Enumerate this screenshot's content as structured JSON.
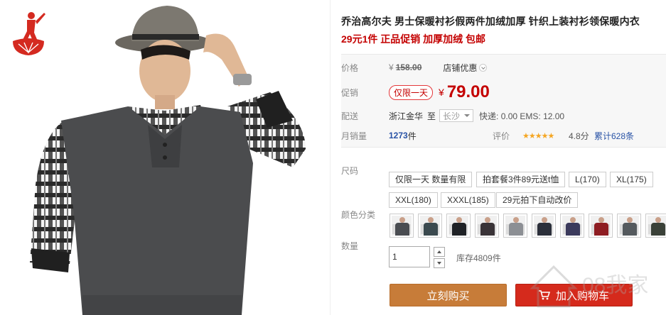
{
  "product": {
    "title": "乔治高尔夫 男士保暖衬衫假两件加绒加厚 针织上装衬衫领保暖内衣",
    "subtitle": "29元1件 正品促销 加厚加绒 包邮"
  },
  "price": {
    "label": "价格",
    "currency": "¥",
    "original": "158.00",
    "shop_discount": "店铺优惠"
  },
  "promo": {
    "label": "促销",
    "badge": "仅限一天",
    "currency": "¥",
    "price": "79.00"
  },
  "delivery": {
    "label": "配送",
    "from": "浙江金华",
    "to": "至",
    "city": "长沙",
    "shipping": "快递: 0.00 EMS: 12.00"
  },
  "sales": {
    "label": "月销量",
    "count": "1273",
    "unit": "件",
    "rating_label": "评价",
    "stars": "★★★★★",
    "score": "4.8分",
    "reviews": "累计628条",
    "rating_value": 4.8
  },
  "sizes": {
    "label": "尺码",
    "options": [
      "仅限一天 数量有限",
      "拍套餐3件89元送t恤",
      "L(170)",
      "XL(175)",
      "XXL(180)",
      "XXXL(185)",
      "29元拍下自动改价"
    ]
  },
  "colors": {
    "label": "颜色分类",
    "swatches": [
      "#4a4d52",
      "#3b4a4f",
      "#1f2226",
      "#3a3438",
      "#8c8f94",
      "#2b2f3a",
      "#3b3a5c",
      "#8e1d22",
      "#555a5e",
      "#3a4138"
    ]
  },
  "quantity": {
    "label": "数量",
    "value": "1",
    "stock": "库存4809件"
  },
  "actions": {
    "buy_now": "立刻购买",
    "add_to_cart": "加入购物车"
  },
  "colors_ui": {
    "accent_red": "#c40000",
    "buy_button": "#c77c39",
    "cart_button": "#d52a1c",
    "link_blue": "#2953a6"
  },
  "icons": {
    "brand_logo": "golfer-logo-icon",
    "cart": "shopping-cart-icon",
    "watermark": "house-watermark-icon"
  },
  "watermark_text": "08我家"
}
